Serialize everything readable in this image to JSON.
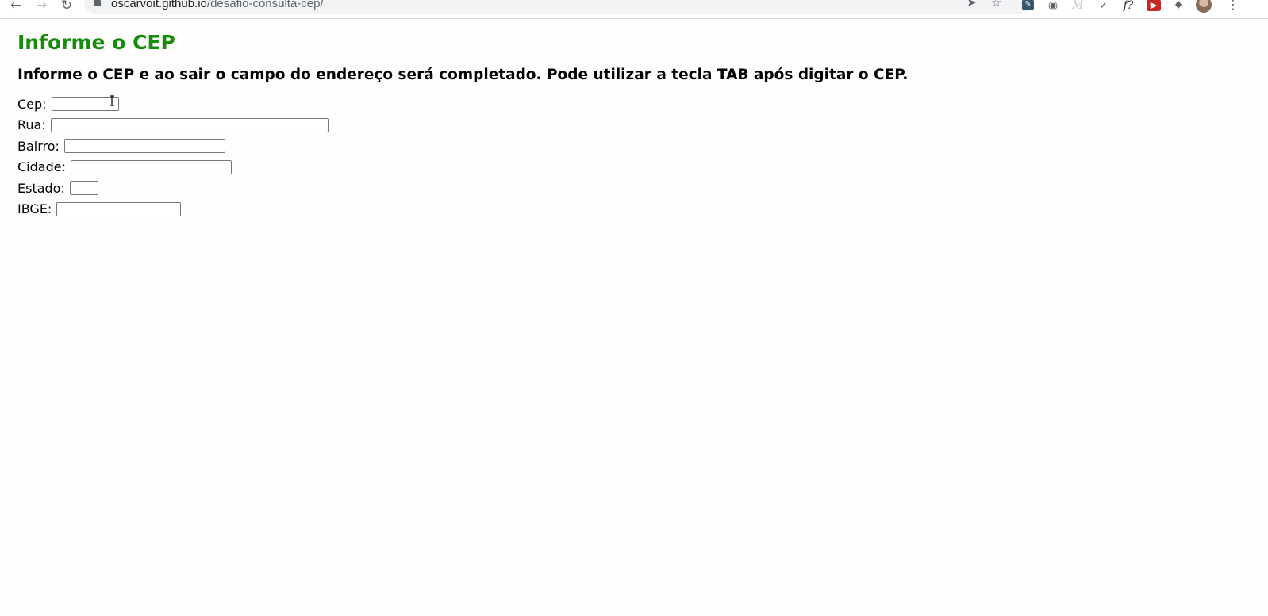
{
  "browser": {
    "url_host": "oscarvoit.github.io",
    "url_path": "/desafio-consulta-cep/",
    "back_icon": "arrow-left-icon",
    "forward_icon": "arrow-right-icon",
    "reload_icon": "reload-icon",
    "send_icon": "send-icon",
    "bookmark_icon": "star-icon",
    "extensions": [
      "docs-extension-icon",
      "camera-icon",
      "m-extension-icon",
      "eyedropper-icon",
      "fx-extension-icon",
      "pdf-extension-icon",
      "puzzle-icon"
    ],
    "avatar": "profile-avatar",
    "menu_icon": "kebab-menu-icon"
  },
  "page": {
    "title": "Informe o CEP",
    "subtitle": "Informe o CEP e ao sair o campo do endereço será completado. Pode utilizar a tecla TAB após digitar o CEP.",
    "title_color": "#158d0c",
    "fields": {
      "cep": {
        "label": "Cep:",
        "value": ""
      },
      "rua": {
        "label": "Rua:",
        "value": ""
      },
      "bairro": {
        "label": "Bairro:",
        "value": ""
      },
      "cidade": {
        "label": "Cidade:",
        "value": ""
      },
      "estado": {
        "label": "Estado:",
        "value": ""
      },
      "ibge": {
        "label": "IBGE:",
        "value": ""
      }
    }
  }
}
